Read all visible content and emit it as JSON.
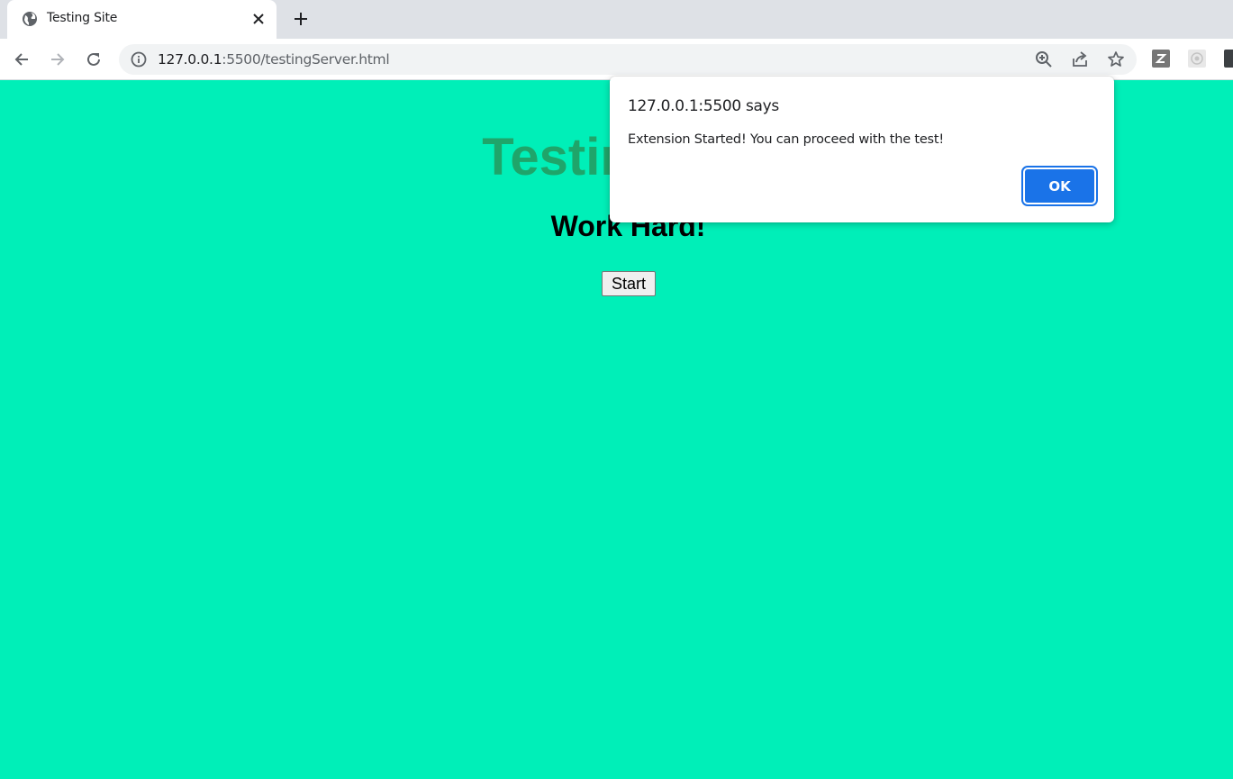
{
  "browser": {
    "tab": {
      "title": "Testing Site"
    },
    "address": {
      "host": "127.0.0.1",
      "path": ":5500/testingServer.html"
    }
  },
  "page": {
    "heading": "Testing Site",
    "subheading": "Work Hard!",
    "start_button_label": "Start",
    "background_color": "#00efb8"
  },
  "dialog": {
    "title": "127.0.0.1:5500 says",
    "message": "Extension Started! You can proceed with the test!",
    "ok_label": "OK"
  }
}
